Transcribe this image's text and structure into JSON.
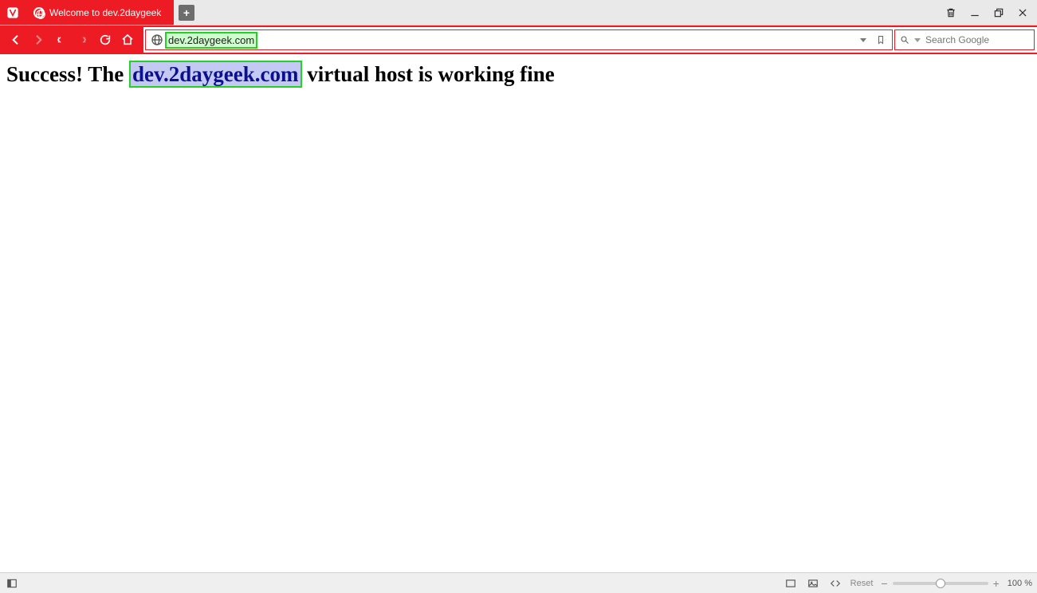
{
  "titlebar": {
    "tab_title": "Welcome to dev.2daygeek"
  },
  "navbar": {
    "url": "dev.2daygeek.com"
  },
  "search": {
    "placeholder": "Search Google"
  },
  "page": {
    "h1_prefix": "Success! The ",
    "h1_highlight": "dev.2daygeek.com",
    "h1_suffix": " virtual host is working fine"
  },
  "statusbar": {
    "reset_label": "Reset",
    "zoom_label": "100 %"
  }
}
